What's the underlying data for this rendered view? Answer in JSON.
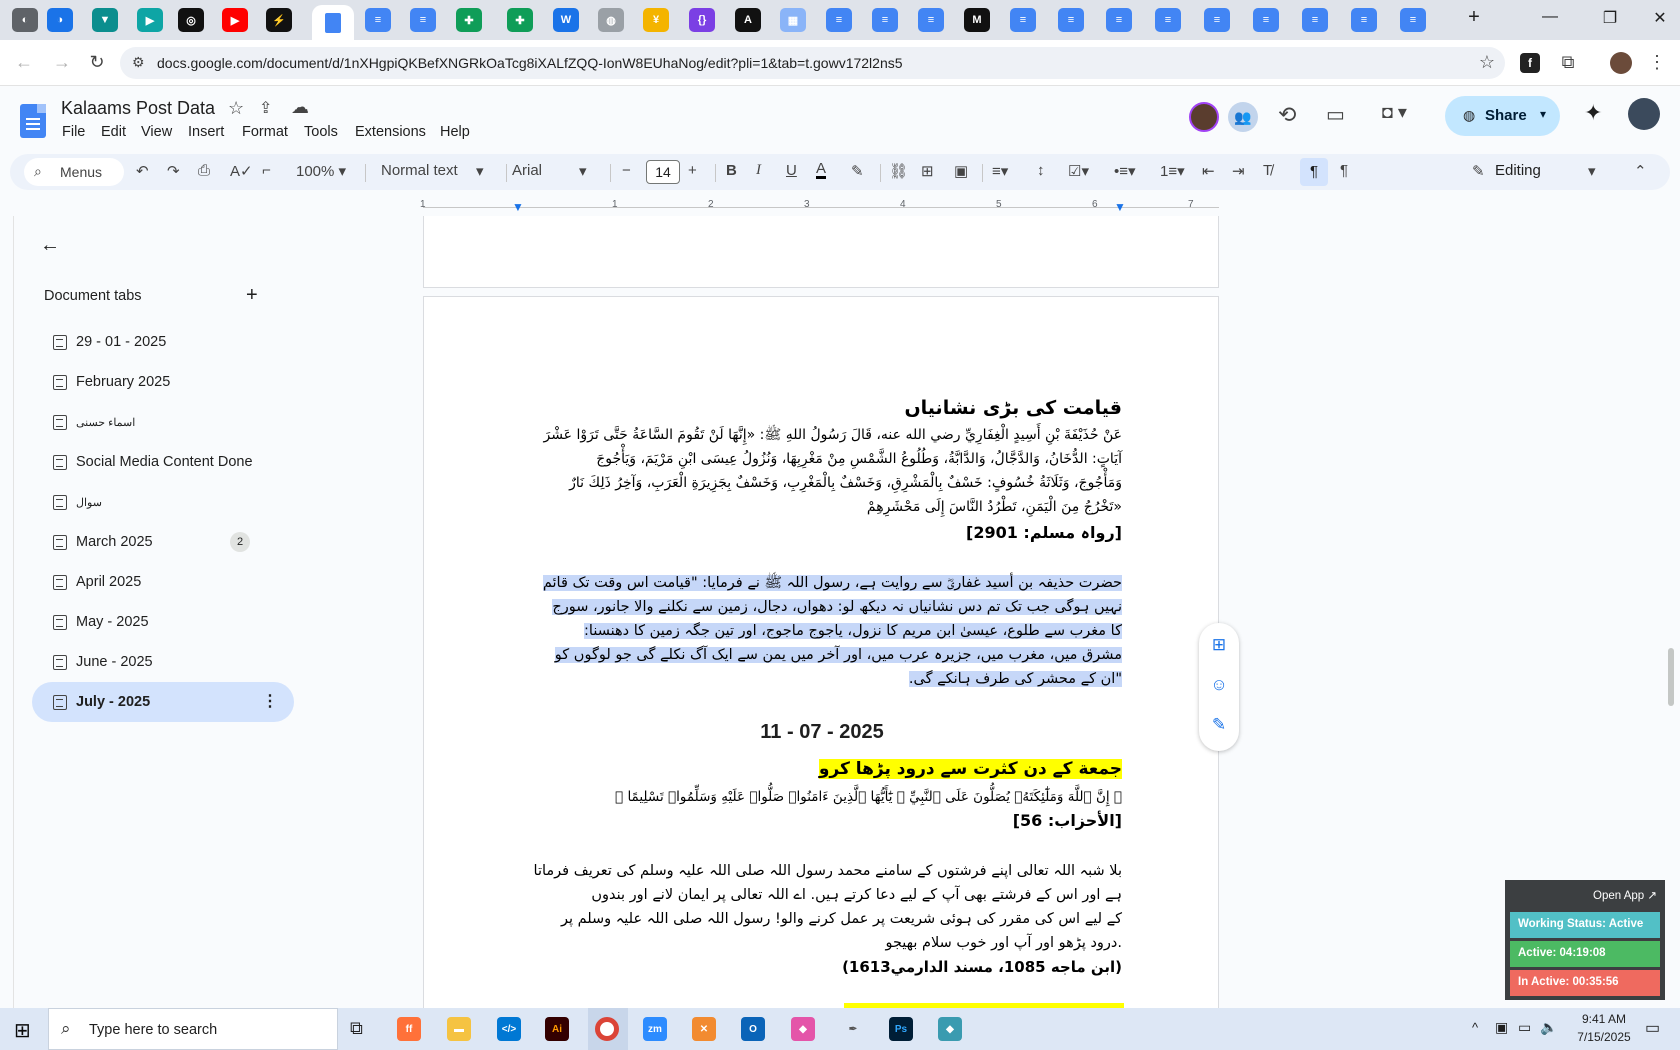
{
  "browser": {
    "url": "docs.google.com/document/d/1nXHgpiQKBefXNGRkOaTcg8iXALfZQQ-IonW8EUhaNog/edit?pli=1&tab=t.gowv172l2ns5",
    "new_tab_label": "+",
    "active_tab_icon": "google-docs-icon"
  },
  "doc": {
    "title": "Kalaams Post Data",
    "menus": [
      "File",
      "Edit",
      "View",
      "Insert",
      "Format",
      "Tools",
      "Extensions",
      "Help"
    ],
    "share_label": "Share"
  },
  "toolbar": {
    "menus_label": "Menus",
    "zoom": "100%",
    "style": "Normal text",
    "font": "Arial",
    "font_size": "14",
    "editing_label": "Editing"
  },
  "ruler": {
    "numbers": [
      "1",
      "1",
      "2",
      "3",
      "4",
      "5",
      "6",
      "7"
    ]
  },
  "sidebar": {
    "title": "Document tabs",
    "add_label": "+",
    "items": [
      {
        "label": "29 - 01 - 2025"
      },
      {
        "label": "February 2025"
      },
      {
        "label": "اسماء حسنی"
      },
      {
        "label": "Social Media Content Done"
      },
      {
        "label": "سوال"
      },
      {
        "label": "March 2025",
        "badge": "2"
      },
      {
        "label": "April 2025"
      },
      {
        "label": "May - 2025"
      },
      {
        "label": "June - 2025"
      },
      {
        "label": "July - 2025",
        "active": true
      }
    ]
  },
  "content": {
    "heading1": "قیامت کی بڑی نشانیاں",
    "arabic1_l1": "عَنْ حُذَيْفَةَ بْنِ أَسِيدٍ الْغِفَارِيِّ رضي الله عنه، قَالَ رَسُولُ اللهِ ﷺ: «إِنَّهَا لَنْ تَقُومَ السَّاعَةُ حَتَّى تَرَوْا عَشْرَ",
    "arabic1_l2": "آيَاتٍ: الدُّخَانُ، وَالدَّجَّالُ، وَالدَّابَّةُ، وَطُلُوعُ الشَّمْسِ مِنْ مَغْرِبِهَا، وَنُزُولُ عِيسَى ابْنِ مَرْيَمَ، وَيَأْجُوجَ",
    "arabic1_l3": "وَمَأْجُوجَ، وَثَلَاثَةُ خُسُوفٍ: خَسْفٌ بِالْمَشْرِقِ، وَخَسْفٌ بِالْمَغْرِبِ، وَخَسْفٌ بِجَزِيرَةِ الْعَرَبِ، وَآخِرُ ذَلِكَ نَارٌ",
    "arabic1_l4": "«تَخْرُجُ مِنَ الْيَمَنِ، تَطْرُدُ النَّاسَ إِلَى مَحْشَرِهِمْ",
    "ref1": "[رواہ مسلم: 2901]",
    "urdu1_l1": "حضرت حذیفہ بن أسید غفاریؓ سے روایت ہے، رسول اللہ ﷺ نے فرمایا: \"قیامت اس وقت تک قائم",
    "urdu1_l2": "نہیں ہوگی جب تک تم دس نشانیاں نہ دیکھ لو: دھواں، دجال، زمین سے نکلنے والا جانور، سورج",
    "urdu1_l3": "کا مغرب سے طلوع، عیسیٰ ابن مریم کا نزول، یاجوج ماجوج، اور تین جگہ زمین کا دھنسنا:",
    "urdu1_l4": "مشرق میں، مغرب میں، جزیرہ عرب میں، اور آخر میں یمن سے ایک آگ نکلے گی جو لوگوں کو",
    "urdu1_l5": "\"ان کے محشر کی طرف ہانکے گی.",
    "date_heading": "11 - 07 - 2025",
    "heading2": "جمعة کے دن کثرت سے درود پڑھا کرو",
    "arabic2": "﴿ إِنَّ ٱللَّهَ وَمَلَٰٓئِكَتَهُۥ يُصَلُّونَ عَلَى ٱلنَّبِيِّ ۚ يَٰٓأَيُّهَا ٱلَّذِينَ ءَامَنُوا۟ صَلُّوا۟ عَلَيْهِ وَسَلِّمُوا۟ تَسْلِيمًا ﴾",
    "ref2": "[الأحزاب: 56]",
    "urdu2_l1": "بلا شبہ اللہ تعالی اپنے فرشتوں کے سامنے محمد رسول اللہ صلی اللہ علیہ وسلم کی تعریف فرماتا",
    "urdu2_l2": "ہے اور اس کے فرشتے بھی آپ کے لیے دعا کرتے ہیں. اے اللہ تعالی پر ایمان لانے اور بندوں",
    "urdu2_l3": "کے لیے اس کی مقرر کی ہوئی شریعت پر عمل کرنے والو! رسول اللہ صلی اللہ علیہ وسلم پر",
    "urdu2_l4": ".درود پڑھو اور آپ اور خوب سلام بھیجو",
    "ref3": "(ابن ماجه 1085، مسند الدارمي1613)"
  },
  "widget": {
    "open_app": "Open App ↗",
    "status": "Working Status: Active",
    "active": "Active: 04:19:08",
    "inactive": "In Active: 00:35:56",
    "colors": {
      "status": "#52c0c6",
      "active": "#4cba63",
      "inactive": "#ef6a5f"
    }
  },
  "taskbar": {
    "search_placeholder": "Type here to search",
    "time": "9:41 AM",
    "date": "7/15/2025"
  }
}
